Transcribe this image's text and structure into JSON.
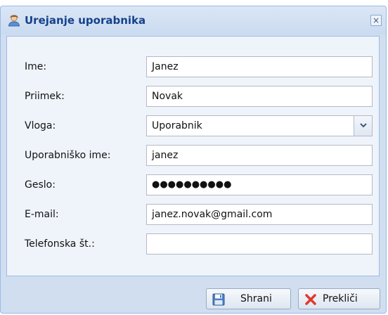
{
  "window": {
    "title": "Urejanje uporabnika",
    "close_glyph": "×"
  },
  "form": {
    "fields": [
      {
        "label": "Ime:",
        "value": "Janez",
        "type": "text"
      },
      {
        "label": "Priimek:",
        "value": "Novak",
        "type": "text"
      },
      {
        "label": "Vloga:",
        "value": "Uporabnik",
        "type": "select"
      },
      {
        "label": "Uporabniško ime:",
        "value": "janez",
        "type": "text"
      },
      {
        "label": "Geslo:",
        "value": "●●●●●●●●●●",
        "type": "password"
      },
      {
        "label": "E-mail:",
        "value": "janez.novak@gmail.com",
        "type": "text"
      },
      {
        "label": "Telefonska št.:",
        "value": "",
        "type": "text"
      }
    ]
  },
  "buttons": {
    "save_label": "Shrani",
    "cancel_label": "Prekliči"
  },
  "icons": {
    "title": "user-icon",
    "save": "floppy-disk-icon",
    "cancel": "red-x-icon",
    "dropdown": "chevron-down-icon"
  },
  "colors": {
    "title_text": "#15428b",
    "window_frame": "#d0def0",
    "panel_bg": "#eff4fb",
    "border": "#99bbe8",
    "cancel_icon": "#e03a2f"
  }
}
